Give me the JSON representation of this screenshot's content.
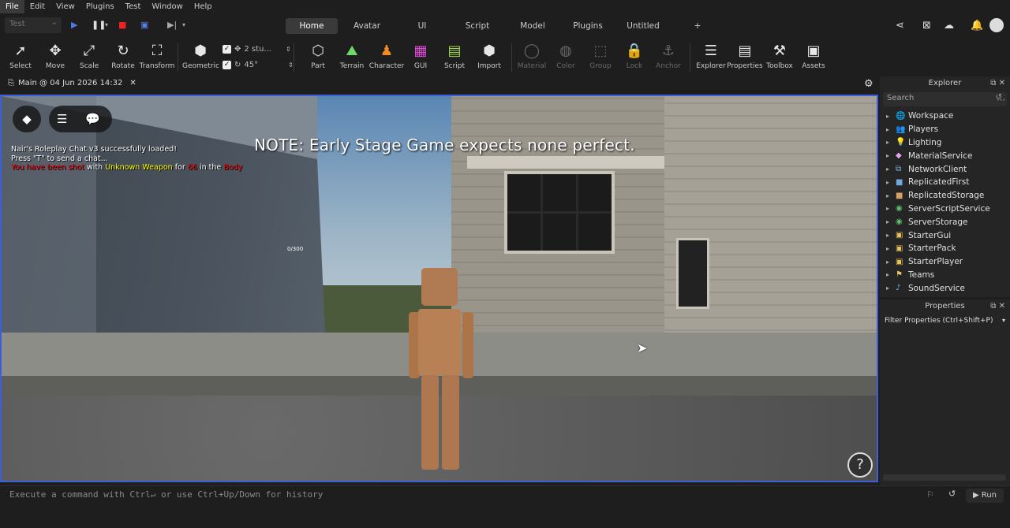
{
  "menu": [
    "File",
    "Edit",
    "View",
    "Plugins",
    "Test",
    "Window",
    "Help"
  ],
  "test_select": "Test",
  "ribbon_tabs": [
    "Home",
    "Avatar",
    "UI",
    "Script",
    "Model",
    "Plugins",
    "Untitled",
    "+"
  ],
  "tools": {
    "select": "Select",
    "move": "Move",
    "scale": "Scale",
    "rotate": "Rotate",
    "transform": "Transform",
    "geometric": "Geometric",
    "snap_move": "2 stu...",
    "snap_rotate": "45°",
    "part": "Part",
    "terrain": "Terrain",
    "character": "Character",
    "gui": "GUI",
    "script": "Script",
    "import": "Import",
    "material": "Material",
    "color": "Color",
    "group": "Group",
    "lock": "Lock",
    "anchor": "Anchor",
    "explorer": "Explorer",
    "properties": "Properties",
    "toolbox": "Toolbox",
    "assets": "Assets"
  },
  "doc_tab": "Main @ 04 Jun 2026 14:32",
  "game": {
    "chat_line1": "Nair's Roleplay Chat v3 successfully loaded!",
    "chat_line2": "Press \"T\" to send a chat...",
    "chat_shot": "You have been shot",
    "chat_with": "with",
    "chat_weapon": "Unknown Weapon",
    "chat_for": "for",
    "chat_dmg": "66",
    "chat_in": "in the",
    "chat_part": "Body",
    "note": "NOTE:  Early Stage Game expects none perfect.",
    "counter": "0/300",
    "help": "?"
  },
  "explorer": {
    "title": "Explorer",
    "search_placeholder": "Search",
    "items": [
      {
        "label": "Workspace",
        "icon": "🌐",
        "color": "#4aa3df"
      },
      {
        "label": "Players",
        "icon": "👥",
        "color": "#8fd16a"
      },
      {
        "label": "Lighting",
        "icon": "💡",
        "color": "#f5d142"
      },
      {
        "label": "MaterialService",
        "icon": "◆",
        "color": "#e2a3f5"
      },
      {
        "label": "NetworkClient",
        "icon": "⧉",
        "color": "#7fb2e5"
      },
      {
        "label": "ReplicatedFirst",
        "icon": "■",
        "color": "#6fa8dc"
      },
      {
        "label": "ReplicatedStorage",
        "icon": "■",
        "color": "#d9a066"
      },
      {
        "label": "ServerScriptService",
        "icon": "◉",
        "color": "#5fbf6a"
      },
      {
        "label": "ServerStorage",
        "icon": "◉",
        "color": "#5fbf6a"
      },
      {
        "label": "StarterGui",
        "icon": "▣",
        "color": "#e6c35c"
      },
      {
        "label": "StarterPack",
        "icon": "▣",
        "color": "#e6c35c"
      },
      {
        "label": "StarterPlayer",
        "icon": "▣",
        "color": "#e6c35c"
      },
      {
        "label": "Teams",
        "icon": "⚑",
        "color": "#e6c35c"
      },
      {
        "label": "SoundService",
        "icon": "♪",
        "color": "#7fb2e5"
      }
    ]
  },
  "properties": {
    "title": "Properties",
    "filter_placeholder": "Filter Properties (Ctrl+Shift+P)"
  },
  "command_bar": {
    "placeholder": "Execute a command with Ctrl↵ or use Ctrl+Up/Down for history",
    "run": "Run"
  }
}
